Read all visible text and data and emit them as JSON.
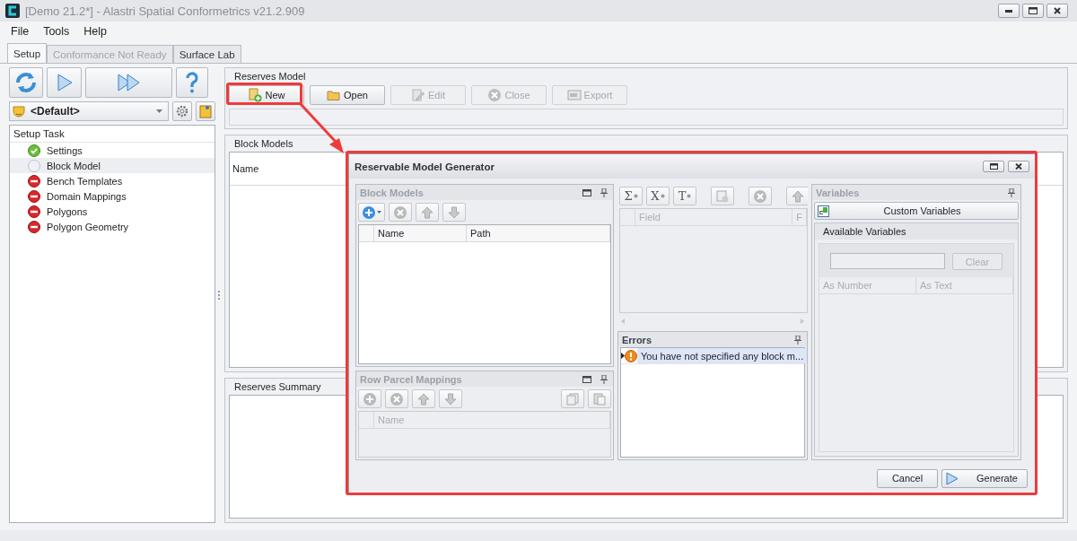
{
  "window": {
    "title": "[Demo 21.2*] - Alastri Spatial Conformetrics v21.2.909"
  },
  "menu": [
    "File",
    "Tools",
    "Help"
  ],
  "tabs": [
    {
      "label": "Setup",
      "selected": true,
      "disabled": false
    },
    {
      "label": "Conformance Not Ready",
      "selected": false,
      "disabled": true
    },
    {
      "label": "Surface Lab",
      "selected": false,
      "disabled": false
    }
  ],
  "left_panel": {
    "profile": "<Default>",
    "tree_header": "Setup Task",
    "tasks": [
      {
        "label": "Settings",
        "kind": "done",
        "selected": false
      },
      {
        "label": "Block Model",
        "kind": "pending",
        "selected": true
      },
      {
        "label": "Bench Templates",
        "kind": "error",
        "selected": false
      },
      {
        "label": "Domain Mappings",
        "kind": "error",
        "selected": false
      },
      {
        "label": "Polygons",
        "kind": "error",
        "selected": false
      },
      {
        "label": "Polygon Geometry",
        "kind": "error",
        "selected": false
      }
    ]
  },
  "reserves_model": {
    "title": "Reserves Model",
    "buttons": [
      {
        "label": "New",
        "kind": "new",
        "disabled": false
      },
      {
        "label": "Open",
        "kind": "open",
        "disabled": false
      },
      {
        "label": "Edit",
        "kind": "edit",
        "disabled": true
      },
      {
        "label": "Close",
        "kind": "close",
        "disabled": true
      },
      {
        "label": "Export",
        "kind": "export",
        "disabled": true
      }
    ]
  },
  "block_models": {
    "title": "Block Models",
    "columns": [
      "Name"
    ]
  },
  "reserves_summary": {
    "title": "Reserves Summary"
  },
  "dialog": {
    "title": "Reservable Model Generator",
    "block_models": {
      "title": "Block Models",
      "columns": [
        "Name",
        "Path"
      ]
    },
    "row_parcel_mappings": {
      "title": "Row Parcel Mappings",
      "columns": [
        "Name"
      ]
    },
    "fields": {
      "tools": [
        "Σ",
        "X",
        "T"
      ],
      "columns": [
        "Field",
        "F"
      ]
    },
    "errors": {
      "title": "Errors",
      "rows": [
        {
          "message": "You have not specified any block m...",
          "selected": true
        }
      ]
    },
    "variables": {
      "title": "Variables",
      "custom_button": "Custom Variables",
      "available": {
        "title": "Available Variables",
        "clear": "Clear",
        "columns": [
          "As Number",
          "As Text"
        ]
      }
    },
    "buttons": {
      "cancel": "Cancel",
      "generate": "Generate"
    }
  }
}
